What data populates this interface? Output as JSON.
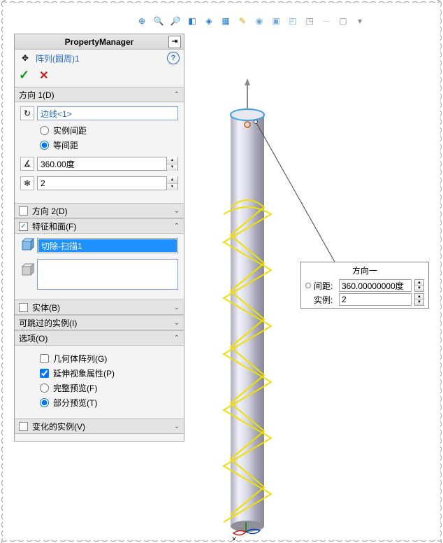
{
  "panel_title": "PropertyManager",
  "feature_name": "阵列(圆周)1",
  "sections": {
    "dir1": {
      "title": "方向 1(D)",
      "edge": "边线<1>",
      "radio_instance_spacing": "实例间距",
      "radio_equal_spacing": "等间距",
      "angle": "360.00度",
      "count": "2"
    },
    "dir2": {
      "title": "方向 2(D)"
    },
    "features": {
      "title": "特征和面(F)",
      "item": "切除-扫描1"
    },
    "bodies": {
      "title": "实体(B)"
    },
    "skip": {
      "title": "可跳过的实例(I)"
    },
    "options": {
      "title": "选项(O)",
      "geometry_pattern": "几何体阵列(G)",
      "propagate_visual": "延伸视象属性(P)",
      "full_preview": "完整预览(F)",
      "partial_preview": "部分预览(T)"
    },
    "vary": {
      "title": "变化的实例(V)"
    }
  },
  "callout": {
    "title": "方向一",
    "spacing_label": "间距:",
    "spacing_value": "360.00000000度",
    "instances_label": "实例:",
    "instances_value": "2"
  }
}
